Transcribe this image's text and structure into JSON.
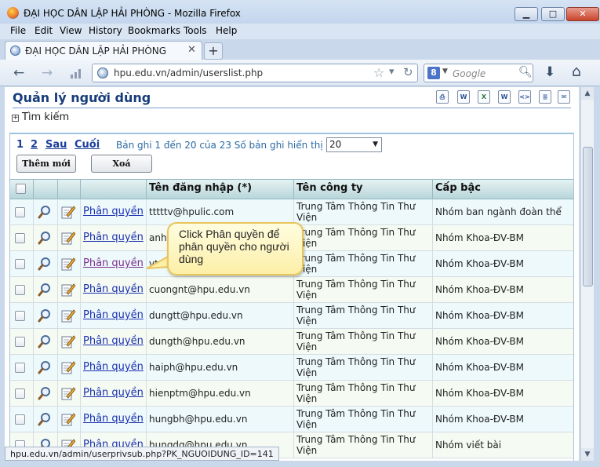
{
  "window": {
    "title": "ĐẠI HỌC DÂN LẬP HẢI PHÒNG - Mozilla Firefox",
    "minimize": "▁",
    "maximize": "□",
    "close": "✕"
  },
  "menu": [
    "File",
    "Edit",
    "View",
    "History",
    "Bookmarks",
    "Tools",
    "Help"
  ],
  "tab": {
    "title": "ĐẠI HỌC DÂN LẬP HẢI PHÒNG",
    "close": "✕",
    "new_tab": "+"
  },
  "nav": {
    "url": "hpu.edu.vn/admin/userslist.php",
    "search_engine": "8",
    "search_placeholder": "Google",
    "back_icon": "back-arrow-icon",
    "forward_icon": "forward-arrow-icon"
  },
  "page": {
    "title": "Quản lý người dùng",
    "search_toggle": "Tìm kiếm",
    "export_icons": [
      "printer-icon",
      "word-icon",
      "excel-icon",
      "word-icon",
      "html-icon",
      "xml-icon",
      "email-icon"
    ]
  },
  "pager": {
    "pages": [
      "1",
      "2"
    ],
    "next": "Sau",
    "last": "Cuối",
    "info": "Bản ghi 1 đến 20 của 23 Số bản ghi hiển thị",
    "page_size": "20"
  },
  "buttons": {
    "add": "Thêm mới",
    "delete": "Xoá"
  },
  "table": {
    "headers": [
      "Tên đăng nhập (*)",
      "Tên công ty",
      "Cấp bậc"
    ],
    "link_label": "Phân quyền",
    "rows": [
      {
        "username": "tttttv@hpulic.com",
        "company": "Trung Tâm Thông Tin Thư Viện",
        "rank": "Nhóm ban ngành đoàn thể"
      },
      {
        "username": "anh",
        "company": "Trung Tâm Thông Tin Thư Viện",
        "rank": "Nhóm Khoa-ĐV-BM"
      },
      {
        "username": "vtc",
        "company": "Trung Tâm Thông Tin Thư Viện",
        "rank": "Nhóm Khoa-ĐV-BM"
      },
      {
        "username": "cuongnt@hpu.edu.vn",
        "company": "Trung Tâm Thông Tin Thư Viện",
        "rank": "Nhóm Khoa-ĐV-BM"
      },
      {
        "username": "dungtt@hpu.edu.vn",
        "company": "Trung Tâm Thông Tin Thư Viện",
        "rank": "Nhóm Khoa-ĐV-BM"
      },
      {
        "username": "dungth@hpu.edu.vn",
        "company": "Trung Tâm Thông Tin Thư Viện",
        "rank": "Nhóm Khoa-ĐV-BM"
      },
      {
        "username": "haiph@hpu.edu.vn",
        "company": "Trung Tâm Thông Tin Thư Viện",
        "rank": "Nhóm Khoa-ĐV-BM"
      },
      {
        "username": "hienptm@hpu.edu.vn",
        "company": "Trung Tâm Thông Tin Thư Viện",
        "rank": "Nhóm Khoa-ĐV-BM"
      },
      {
        "username": "hungbh@hpu.edu.vn",
        "company": "Trung Tâm Thông Tin Thư Viện",
        "rank": "Nhóm Khoa-ĐV-BM"
      },
      {
        "username": "hungdq@hpu.edu.vn",
        "company": "Trung Tâm Thông Tin Thư Viện",
        "rank": "Nhóm viết bài"
      }
    ]
  },
  "callout": "Click Phân quyền để phân quyền cho người dùng",
  "status": "hpu.edu.vn/admin/userprivsub.php?PK_NGUOIDUNG_ID=141"
}
